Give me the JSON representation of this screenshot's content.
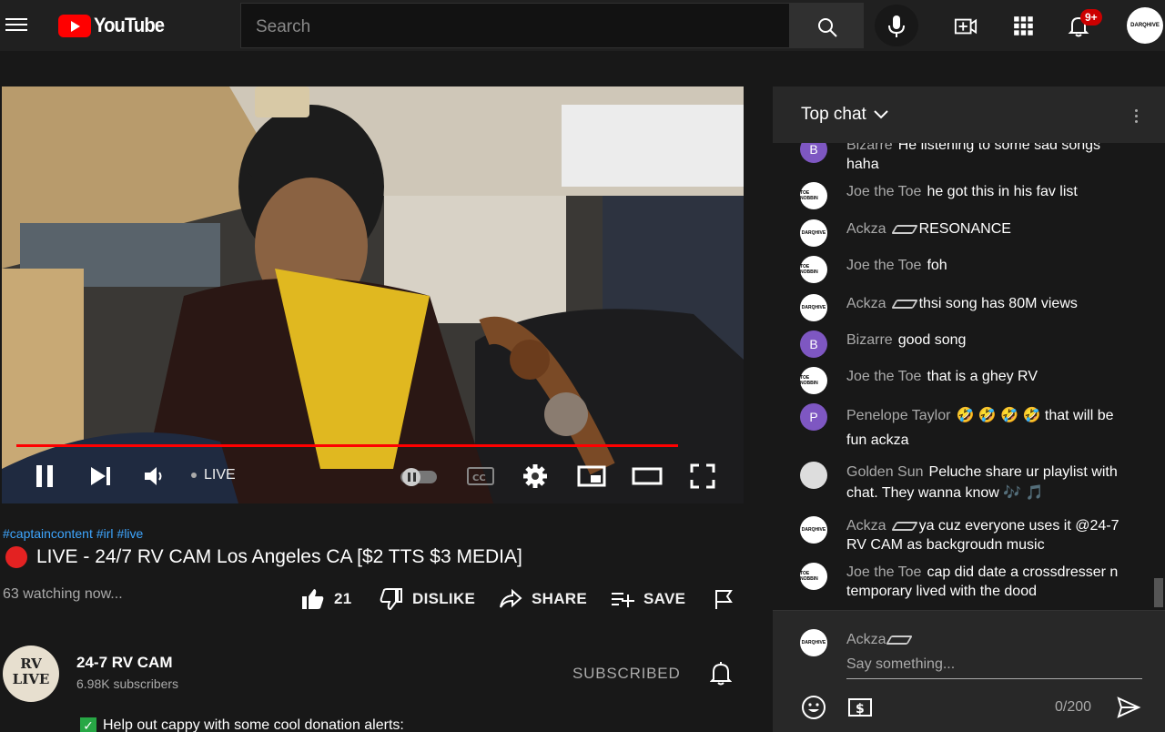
{
  "masthead": {
    "logo_text": "YouTube",
    "search_placeholder": "Search",
    "notification_count": "9+",
    "account_label": "DARQHIVE"
  },
  "player": {
    "live_label": "LIVE"
  },
  "video": {
    "hashtags": [
      "#captaincontent",
      "#irl",
      "#live"
    ],
    "title": "LIVE - 24/7 RV CAM Los Angeles CA [$2 TTS $3 MEDIA]",
    "watching": "63 watching now...",
    "like_count": "21",
    "dislike_label": "DISLIKE",
    "share_label": "SHARE",
    "save_label": "SAVE"
  },
  "channel": {
    "avatar_text": "RV LIVE",
    "name": "24-7 RV CAM",
    "subscribers": "6.98K subscribers",
    "subscribe_label": "SUBSCRIBED",
    "description_line": "Help out cappy with some cool donation alerts:"
  },
  "chat": {
    "header_title": "Top chat",
    "messages": [
      {
        "author": "Bizarre",
        "text": "He listening to some sad songs haha",
        "avatar": "B",
        "avatar_type": "purple"
      },
      {
        "author": "Joe the Toe",
        "text": "he got this in his fav list",
        "avatar": "TOE NOBBIN",
        "avatar_type": "light"
      },
      {
        "author": "Ackza",
        "text": "RESONANCE",
        "avatar": "DARQHIVE",
        "avatar_type": "light"
      },
      {
        "author": "Joe the Toe",
        "text": "foh",
        "avatar": "TOE NOBBIN",
        "avatar_type": "light"
      },
      {
        "author": "Ackza",
        "text": "thsi song has 80M views",
        "avatar": "DARQHIVE",
        "avatar_type": "light"
      },
      {
        "author": "Bizarre",
        "text": "good song",
        "avatar": "B",
        "avatar_type": "purple"
      },
      {
        "author": "Joe the Toe",
        "text": "that is a ghey RV",
        "avatar": "TOE NOBBIN",
        "avatar_type": "light"
      },
      {
        "author": "Penelope Taylor",
        "text": "🤣 🤣 🤣 🤣 that will be fun ackza",
        "avatar": "P",
        "avatar_type": "purple"
      },
      {
        "author": "Golden Sun",
        "text": "Peluche share ur playlist with chat. They wanna know 🎶 🎵",
        "avatar": "",
        "avatar_type": "flag"
      },
      {
        "author": "Ackza",
        "text": "ya cuz everyone uses it @24-7 RV CAM as backgroudn music",
        "avatar": "DARQHIVE",
        "avatar_type": "light"
      },
      {
        "author": "Joe the Toe",
        "text": "cap did date a crossdresser n temporary lived with the dood",
        "avatar": "TOE NOBBIN",
        "avatar_type": "light"
      }
    ],
    "footer_author": "Ackza",
    "footer_avatar": "DARQHIVE",
    "input_placeholder": "Say something...",
    "char_counter": "0/200"
  }
}
